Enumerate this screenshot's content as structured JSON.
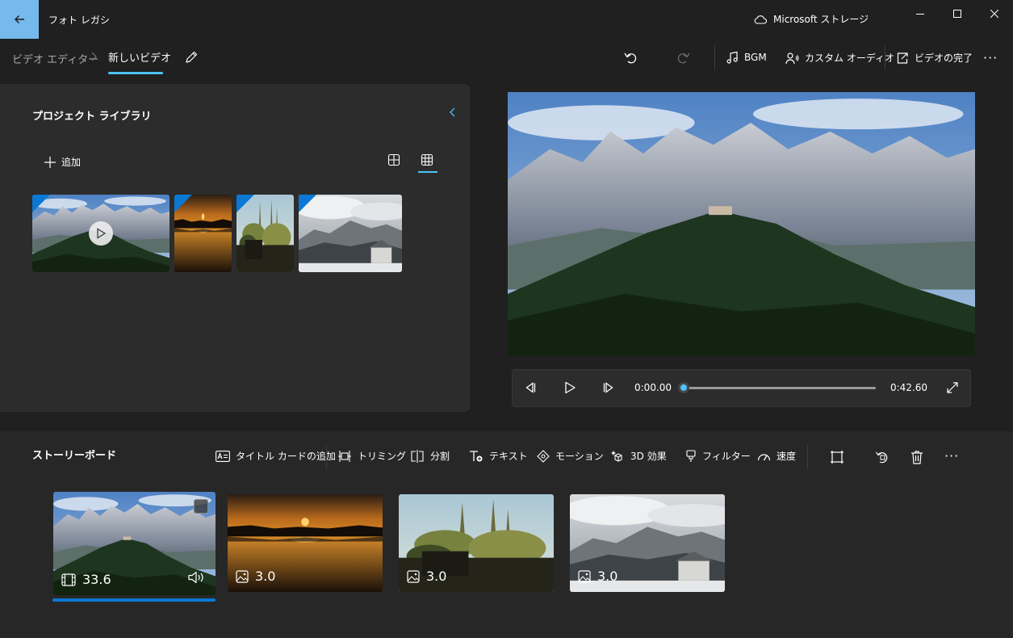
{
  "titlebar": {
    "app_title": "フォト レガシ",
    "storage_label": "Microsoft ストレージ"
  },
  "nav": {
    "breadcrumb_root": "ビデオ エディター",
    "breadcrumb_sep": ">",
    "breadcrumb_current": "新しいビデオ"
  },
  "toolbar": {
    "bgm_label": "BGM",
    "custom_audio_label": "カスタム オーディオ",
    "finish_video_label": "ビデオの完了",
    "more_label": "···"
  },
  "library": {
    "title": "プロジェクト ライブラリ",
    "add_label": "追加",
    "items": [
      {
        "type": "video",
        "scene": "mountains"
      },
      {
        "type": "photo",
        "scene": "sunset-lake"
      },
      {
        "type": "photo",
        "scene": "trees"
      },
      {
        "type": "photo",
        "scene": "snowy-village"
      }
    ]
  },
  "player": {
    "current_time": "0:00.00",
    "total_time": "0:42.60",
    "progress": 0.0
  },
  "storyboard": {
    "title": "ストーリーボード",
    "actions": {
      "title_card": "タイトル カードの追加",
      "trim": "トリミング",
      "split": "分割",
      "text": "テキスト",
      "motion": "モーション",
      "effects3d": "3D 効果",
      "filters": "フィルター",
      "speed": "速度",
      "more": "···"
    },
    "clips": [
      {
        "duration": "33.6",
        "kind": "video",
        "scene": "mountains",
        "selected": true
      },
      {
        "duration": "3.0",
        "kind": "photo",
        "scene": "sunset-lake"
      },
      {
        "duration": "3.0",
        "kind": "photo",
        "scene": "trees"
      },
      {
        "duration": "3.0",
        "kind": "photo",
        "scene": "snowy-village"
      }
    ]
  },
  "colors": {
    "accent": "#0a78d4",
    "accent_light": "#4cc2ff",
    "back_button": "#76b9ed",
    "background": "#202020",
    "panel": "#2c2c2c"
  }
}
